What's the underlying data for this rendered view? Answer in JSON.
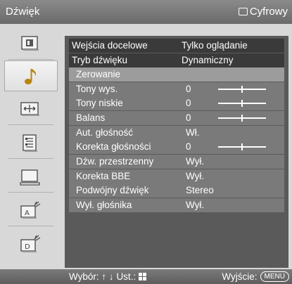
{
  "header": {
    "title": "Dźwięk",
    "source_label": "Cyfrowy",
    "source_icon": "rectangle-outline-icon"
  },
  "sidebar": {
    "items": [
      {
        "icon": "picture-icon",
        "selected": false
      },
      {
        "icon": "music-note-icon",
        "selected": true
      },
      {
        "icon": "screen-format-icon",
        "selected": false
      },
      {
        "icon": "settings-list-icon",
        "selected": false
      },
      {
        "icon": "pc-monitor-icon",
        "selected": false
      },
      {
        "icon": "analog-antenna-icon",
        "selected": false
      },
      {
        "icon": "digital-antenna-icon",
        "selected": false
      }
    ]
  },
  "menu": {
    "rows": [
      {
        "label": "Wejścia docelowe",
        "value": "Tylko oglądanie",
        "kind": "main"
      },
      {
        "label": "Tryb dźwięku",
        "value": "Dynamiczny",
        "kind": "main"
      },
      {
        "label": "Zerowanie",
        "value": "",
        "kind": "sub-highlight"
      },
      {
        "label": "Tony wys.",
        "value": "0",
        "kind": "sub",
        "slider": 0.5
      },
      {
        "label": "Tony niskie",
        "value": "0",
        "kind": "sub",
        "slider": 0.5
      },
      {
        "label": "Balans",
        "value": "0",
        "kind": "sub",
        "slider": 0.5
      },
      {
        "label": "Aut. głośność",
        "value": "Wł.",
        "kind": "sub"
      },
      {
        "label": "Korekta głośności",
        "value": "0",
        "kind": "sub",
        "slider": 0.5
      },
      {
        "label": "Dźw. przestrzenny",
        "value": "Wył.",
        "kind": "sub"
      },
      {
        "label": "Korekta BBE",
        "value": "Wył.",
        "kind": "sub"
      },
      {
        "label": "Podwójny dźwięk",
        "value": "Stereo",
        "kind": "sub"
      },
      {
        "label": "Wył. głośnika",
        "value": "Wył.",
        "kind": "sub"
      }
    ]
  },
  "footer": {
    "nav_hint": "Wybór:",
    "nav_arrows": "↑ ↓",
    "confirm_label": "Ust.:",
    "exit_label": "Wyjście:",
    "exit_button": "MENU"
  }
}
